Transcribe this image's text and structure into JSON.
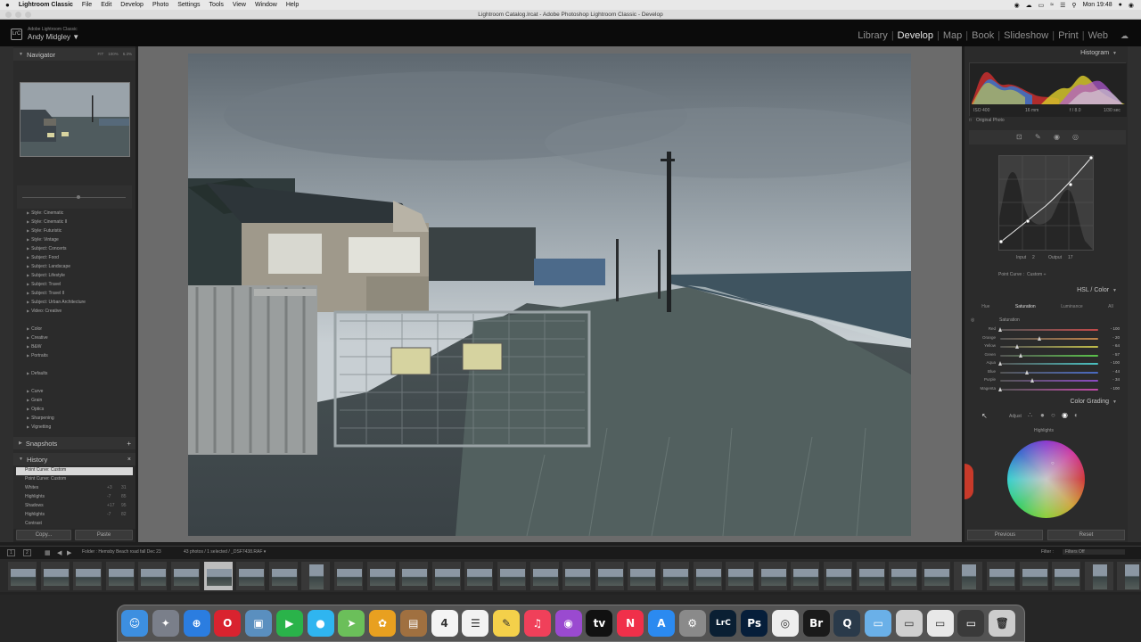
{
  "menubar": {
    "apple": "",
    "app": "Lightroom Classic",
    "items": [
      "File",
      "Edit",
      "Develop",
      "Photo",
      "Settings",
      "Tools",
      "View",
      "Window",
      "Help"
    ],
    "clock": "Mon 19:48"
  },
  "window": {
    "title": "Lightroom Catalog.lrcat - Adobe Photoshop Lightroom Classic - Develop"
  },
  "identity": {
    "logo": "LrC",
    "product": "Adobe Lightroom Classic",
    "user": "Andy Midgley ▼"
  },
  "modules": {
    "items": [
      "Library",
      "Develop",
      "Map",
      "Book",
      "Slideshow",
      "Print",
      "Web"
    ],
    "active": "Develop"
  },
  "left": {
    "navigator": {
      "title": "Navigator",
      "opts": [
        "FIT",
        "100%",
        "6.3%"
      ]
    },
    "presets": [
      "Style: Cinematic",
      "Style: Cinematic II",
      "Style: Futuristic",
      "Style: Vintage",
      "Subject: Concerts",
      "Subject: Food",
      "Subject: Landscape",
      "Subject: Lifestyle",
      "Subject: Travel",
      "Subject: Travel II",
      "Subject: Urban Architecture",
      "Video: Creative"
    ],
    "groups1": [
      "Color",
      "Creative",
      "B&W",
      "Portraits"
    ],
    "groups2": [
      "Defaults"
    ],
    "groups3": [
      "Curve",
      "Grain",
      "Optics",
      "Sharpening",
      "Vignetting"
    ],
    "snapshots": "Snapshots",
    "history": {
      "title": "History",
      "items": [
        {
          "label": "Point Curve: Custom",
          "v1": "",
          "v2": ""
        },
        {
          "label": "Point Curve: Custom",
          "v1": "",
          "v2": ""
        },
        {
          "label": "Whites",
          "v1": "+3",
          "v2": "31"
        },
        {
          "label": "Highlights",
          "v1": "-7",
          "v2": "85"
        },
        {
          "label": "Shadows",
          "v1": "+17",
          "v2": "95"
        },
        {
          "label": "Highlights",
          "v1": "-7",
          "v2": "82"
        },
        {
          "label": "Contrast",
          "v1": "",
          "v2": ""
        }
      ]
    },
    "copy": "Copy...",
    "paste": "Paste"
  },
  "right": {
    "histogram": "Histogram",
    "hist_info": [
      "ISO 400",
      "16 mm",
      "f / 8.0",
      "1/30 sec"
    ],
    "original_photo": "Original Photo",
    "curve": {
      "input_label": "Input",
      "input": "2",
      "output_label": "Output",
      "output": "17",
      "point_curve_label": "Point Curve :",
      "point_curve_value": "Custom ÷"
    },
    "hsl": {
      "title": "HSL / Color",
      "tabs": [
        "Hue",
        "Saturation",
        "Luminance",
        "All"
      ],
      "active": "Saturation",
      "section": "Saturation",
      "sliders": [
        {
          "name": "Red",
          "value": "- 100",
          "pos": 0.0,
          "color": "#c24a4a"
        },
        {
          "name": "Orange",
          "value": "- 20",
          "pos": 0.4,
          "color": "#c2864a"
        },
        {
          "name": "Yellow",
          "value": "- 64",
          "pos": 0.18,
          "color": "#c2be4a"
        },
        {
          "name": "Green",
          "value": "- 57",
          "pos": 0.215,
          "color": "#5ac24a"
        },
        {
          "name": "Aqua",
          "value": "- 100",
          "pos": 0.0,
          "color": "#4ac2c2"
        },
        {
          "name": "Blue",
          "value": "- 44",
          "pos": 0.28,
          "color": "#4a6ac2"
        },
        {
          "name": "Purple",
          "value": "- 34",
          "pos": 0.33,
          "color": "#8a4ac2"
        },
        {
          "name": "Magenta",
          "value": "- 100",
          "pos": 0.0,
          "color": "#c24aa8"
        }
      ]
    },
    "color_grading": {
      "title": "Color Grading",
      "adjust": "Adjust",
      "region": "Highlights"
    },
    "previous": "Previous",
    "reset": "Reset"
  },
  "toolbar": {
    "page1": "1",
    "page2": "2",
    "folder": "Folder : Hemsby Beach road fall Dec 23",
    "count": "43 photos / 1 selected / _DSF7438.RAF ▾",
    "filter": "Filter :",
    "filter_value": "Filters Off"
  },
  "dock": [
    {
      "name": "finder-icon",
      "label": "☺",
      "bg": "#3d8fe0"
    },
    {
      "name": "launchpad-icon",
      "label": "✦",
      "bg": "#7a7f8a"
    },
    {
      "name": "safari-icon",
      "label": "⊕",
      "bg": "#2b7de0"
    },
    {
      "name": "opera-icon",
      "label": "O",
      "bg": "#d9232f"
    },
    {
      "name": "preview-icon",
      "label": "▣",
      "bg": "#5a8fbf"
    },
    {
      "name": "facetime-icon",
      "label": "▶",
      "bg": "#2ab34a"
    },
    {
      "name": "messages-icon",
      "label": "●",
      "bg": "#2fb5f0"
    },
    {
      "name": "maps-icon",
      "label": "➤",
      "bg": "#6bbf5a"
    },
    {
      "name": "photos-icon",
      "label": "✿",
      "bg": "#e8a020"
    },
    {
      "name": "notebook-icon",
      "label": "▤",
      "bg": "#a07040"
    },
    {
      "name": "calendar-icon",
      "label": "4",
      "bg": "#f4f4f4"
    },
    {
      "name": "reminders-icon",
      "label": "☰",
      "bg": "#f2f2f2"
    },
    {
      "name": "notes-icon",
      "label": "✎",
      "bg": "#f4d04a"
    },
    {
      "name": "music-icon",
      "label": "♫",
      "bg": "#f0405a"
    },
    {
      "name": "podcasts-icon",
      "label": "◉",
      "bg": "#9a4ad0"
    },
    {
      "name": "apple-tv-icon",
      "label": "tv",
      "bg": "#111111"
    },
    {
      "name": "news-icon",
      "label": "N",
      "bg": "#f0304a"
    },
    {
      "name": "app-store-icon",
      "label": "A",
      "bg": "#2b8af0"
    },
    {
      "name": "system-settings-icon",
      "label": "⚙",
      "bg": "#8a8a8a"
    },
    {
      "name": "lightroom-classic-icon",
      "label": "LrC",
      "bg": "#0a1f33"
    },
    {
      "name": "photoshop-icon",
      "label": "Ps",
      "bg": "#061e3a"
    },
    {
      "name": "chrome-icon",
      "label": "◎",
      "bg": "#eeeeee"
    },
    {
      "name": "bridge-icon",
      "label": "Br",
      "bg": "#1a1a1a"
    },
    {
      "name": "quicktime-icon",
      "label": "Q",
      "bg": "#2a3a4a"
    },
    {
      "name": "downloads-folder-icon",
      "label": "▭",
      "bg": "#6ab0e8"
    },
    {
      "name": "finder-window-icon",
      "label": "▭",
      "bg": "#cfcfcf"
    },
    {
      "name": "document-icon",
      "label": "▭",
      "bg": "#e8e8e8"
    },
    {
      "name": "window-icon",
      "label": "▭",
      "bg": "#3a3a3a"
    },
    {
      "name": "trash-icon",
      "label": "🗑",
      "bg": "#cccccc"
    }
  ],
  "colors": {
    "panel": "#2b2b2b",
    "background": "#6b6b6b",
    "accent": "#e6e6e6"
  }
}
